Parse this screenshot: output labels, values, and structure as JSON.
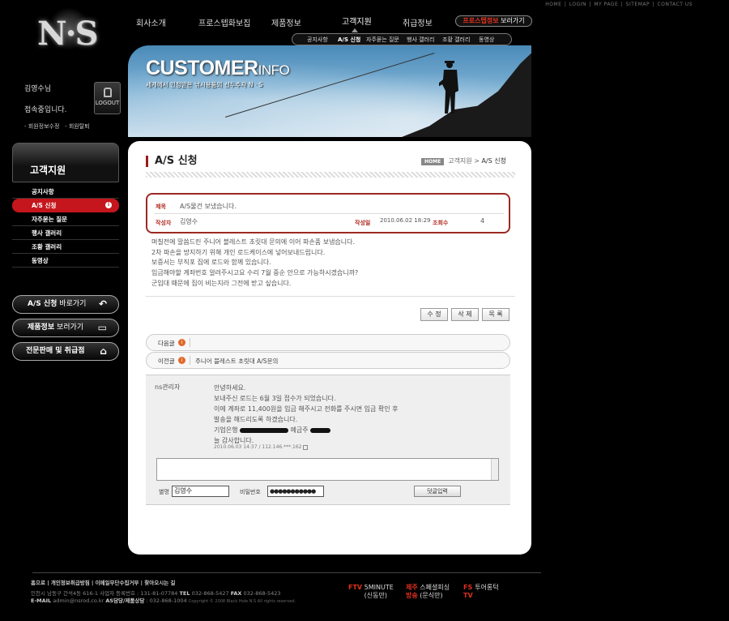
{
  "brand": {
    "logo": "N·S"
  },
  "top_links": [
    "HOME",
    "LOGIN",
    "MY PAGE",
    "SITEMAP",
    "CONTACT US"
  ],
  "main_nav": [
    "회사소개",
    "프로스텝화보집",
    "제품정보",
    "고객지원",
    "취급정보"
  ],
  "promo_pill": {
    "red": "프로스텝정보",
    "white": "보러가기"
  },
  "sub_nav": [
    "공지사항",
    "A/S 신청",
    "자주묻는 질문",
    "행사 갤러리",
    "조황 갤러리",
    "동영상"
  ],
  "banner": {
    "title_big": "CUSTOMER",
    "title_small": "INFO",
    "subtitle": "세계에서 인정받은 낚시용품의 선두주자 N · S"
  },
  "user": {
    "name": "김영수님",
    "welcome": "접속중입니다.",
    "logout": "LOGOUT",
    "link_edit": "- 회원정보수정",
    "link_leave": "- 회원탈퇴"
  },
  "side": {
    "title": "고객지원",
    "items": [
      "공지사항",
      "A/S 신청",
      "자주묻는 질문",
      "행사 갤러리",
      "조황 갤러리",
      "동영상"
    ],
    "active_dot": "i"
  },
  "quick": [
    {
      "bold": "A/S 신청",
      "normal": " 바로가기",
      "icon": "↶"
    },
    {
      "bold": "제품정보",
      "normal": " 보러가기",
      "icon": "▭"
    },
    {
      "bold": "전문판매 및 취급점",
      "normal": "",
      "icon": "⌂"
    }
  ],
  "page": {
    "title": "A/S 신청",
    "crumb_home": "HOME",
    "crumb_mid": "고객지원",
    "crumb_sep": ">",
    "crumb_cur": "A/S 신청"
  },
  "post": {
    "subject_label": "제목",
    "subject": "A/S물건 보냈습니다.",
    "author_label": "작성자",
    "author": "김영수",
    "date_label": "작성일",
    "date": "2010.06.02 18:29",
    "views_label": "조회수",
    "views": "4",
    "body": [
      "며칠전에 말씀드린 주니어 블레스트 초릿대 문의에 이어 파손품 보냅습니다.",
      "2차 파손을 방지하기 위해 개인 로드케이스에 넣어보내드립니다.",
      "보증서는 부직포 집에 로드와 함께 있습니다.",
      "입금해야할 계좌번호 알려주시고요 수리 7월 중순 안으로 가능하시겠습니까?",
      "군입대 때문에 집이 비는지라 그전에 받고 싶습니다."
    ]
  },
  "buttons": {
    "edit": "수 정",
    "delete": "삭 제",
    "list": "목 록"
  },
  "nav_next": {
    "label": "다음글",
    "icon": "i",
    "title": ""
  },
  "nav_prev": {
    "label": "이전글",
    "icon": "i",
    "title": "주니어 블레스트 초릿대 A/S문의"
  },
  "comment": {
    "name": "ns관리자",
    "lines": [
      "안녕하세요.",
      "보내주신 로드는 6월 3일 접수가 되었습니다.",
      "이에 계좌로 11,400원을 입금 해주시고 전화를 주시면 입금 확인 후",
      "발송을 해드리도록 하겠습니다."
    ],
    "bank_prefix": "기업은행 ",
    "bank_mid": " 예금주 ",
    "last_line": "늘 감사합니다.",
    "meta": "2010.06.03 14:37 / 112.146.***.162"
  },
  "form": {
    "name_label": "별명",
    "name_value": "김영수",
    "pw_label": "비밀번호",
    "pw_value": "●●●●●●●●●●●",
    "submit": "덧글입력"
  },
  "footer": {
    "links": "홈으로 | 개인정보취급방침 | 이메일무단수집거부 | 찾아오시는 길",
    "addr1": "인천시 남동구 간석4동 616-1   사업자 등록번호 : 131-81-07784   ",
    "tel_label": "TEL",
    "tel": " 032-868-5427   ",
    "fax_label": "FAX",
    "fax": " 032-868-5423",
    "email_label": "E-MAIL",
    "email": " admin@nsrod.co.kr ",
    "as_label": "AS담당/제품상담",
    "as_tel": " : 032-868-1004",
    "copyright": "Copyright © 2008 Black Hole N.S All rights reserved.",
    "brands": [
      {
        "red": "FTV",
        "white": "5MINUTE\n(신동만)"
      },
      {
        "red": "제주\n방송",
        "white": "스페셜피싱\n(문식만)"
      },
      {
        "red": "FS\nTV",
        "white": "투어롱턱"
      }
    ]
  }
}
